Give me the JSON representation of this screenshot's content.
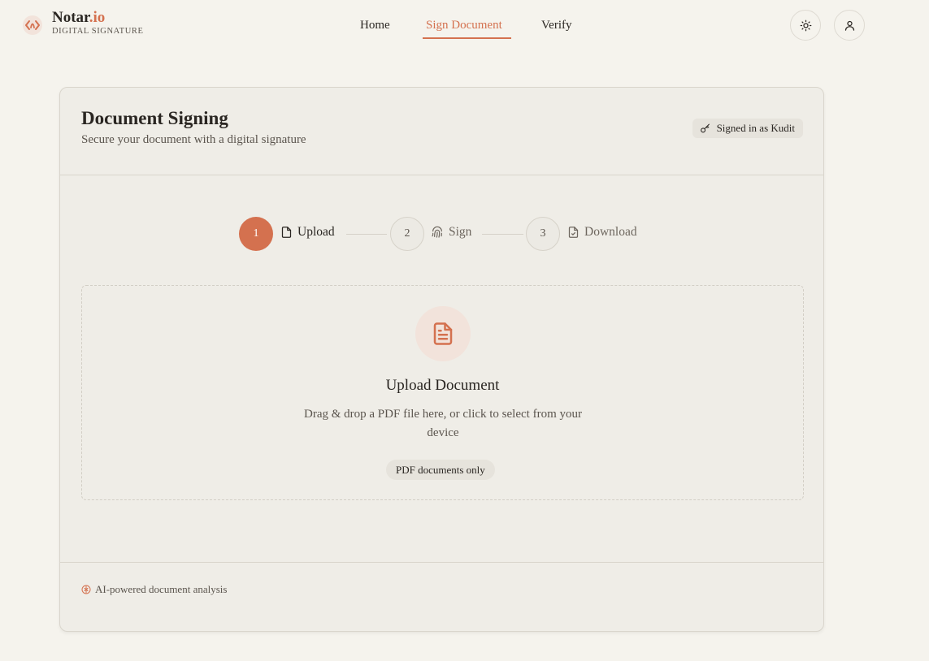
{
  "brand": {
    "name_main": "Notar",
    "name_accent": ".io",
    "subtitle": "DIGITAL SIGNATURE",
    "logo_icon": "notario-logo-icon"
  },
  "nav": {
    "items": [
      {
        "label": "Home",
        "active": false
      },
      {
        "label": "Sign Document",
        "active": true
      },
      {
        "label": "Verify",
        "active": false
      }
    ]
  },
  "header_actions": {
    "theme_icon": "sun-icon",
    "account_icon": "user-icon"
  },
  "card": {
    "title": "Document Signing",
    "subtitle": "Secure your document with a digital signature",
    "signed_in_badge": "Signed in as Kudit",
    "badge_icon": "key-icon"
  },
  "stepper": {
    "steps": [
      {
        "number": "1",
        "label": "Upload",
        "icon": "file-icon",
        "active": true
      },
      {
        "number": "2",
        "label": "Sign",
        "icon": "fingerprint-icon",
        "active": false
      },
      {
        "number": "3",
        "label": "Download",
        "icon": "file-check-icon",
        "active": false
      }
    ]
  },
  "dropzone": {
    "icon": "file-text-icon",
    "title": "Upload Document",
    "description": "Drag & drop a PDF file here, or click to select from your device",
    "pill": "PDF documents only"
  },
  "footer": {
    "note": "AI-powered document analysis",
    "note_icon": "brain-icon"
  },
  "colors": {
    "accent": "#d4714f",
    "background": "#f5f3ed",
    "card": "#efede7",
    "text": "#2a2622"
  }
}
